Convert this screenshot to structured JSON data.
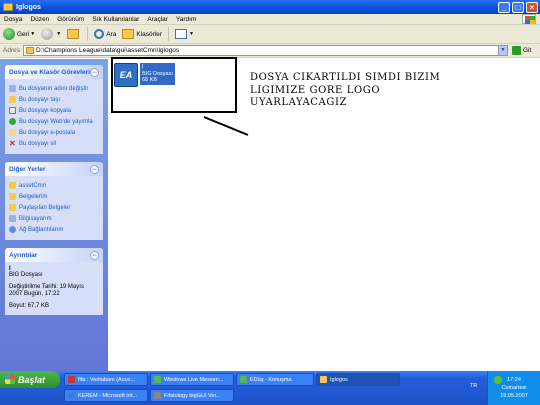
{
  "window": {
    "title": "Iglogos"
  },
  "menu": [
    "Dosya",
    "Düzen",
    "Görünüm",
    "Sık Kullanılanlar",
    "Araçlar",
    "Yardım"
  ],
  "toolbar": {
    "back": "Geri",
    "search": "Ara",
    "folders": "Klasörler"
  },
  "address": {
    "label": "Adres",
    "path": "D:\\Champions League\\data\\gui\\assetCmn\\lglogos",
    "go": "Git"
  },
  "tasks_panel": {
    "title": "Dosya ve Klasör Görevleri",
    "links": [
      "Bu dosyanın adını değiştir",
      "Bu dosyayı taşı",
      "Bu dosyayı kopyala",
      "Bu dosyayı Web'de yayımla",
      "Bu dosyayı e-postala",
      "Bu dosyayı sil"
    ]
  },
  "places_panel": {
    "title": "Diğer Yerler",
    "links": [
      "assetCmn",
      "Belgelerim",
      "Paylaşılan Belgeler",
      "Bilgisayarım",
      "Ağ Bağlantılarım"
    ]
  },
  "details_panel": {
    "title": "Ayrıntılar",
    "name": "I",
    "type": "BIG Dosyası",
    "modified_1": "Değiştirilme Tarihi: 19 Mayıs",
    "modified_2": "2007 Bugün, 17:22",
    "size": "Boyut: 67,7 KB"
  },
  "file": {
    "name": "I",
    "type": "BIG Dosyası",
    "size": "68 KB",
    "icon_text": "EA"
  },
  "note": {
    "line1": "DOSYA CIKARTILDI SIMDI BIZIM",
    "line2": "LIGIMIZE GORE LOGO",
    "line3": "UYARLAYACAGIZ"
  },
  "taskbar": {
    "start": "Başlat",
    "tasks_row1": [
      "fifa : Veritabanı (Acce...",
      "Windows Live Messen...",
      "EDüş - Konuşma",
      "Iglogos"
    ],
    "tasks_row2": [
      "KEREM - Microsoft Int...",
      "Fifatology bigGUI Ver..."
    ],
    "lang": "TR",
    "time": "17:24",
    "day": "Cumartesi",
    "date": "19.05.2007"
  }
}
